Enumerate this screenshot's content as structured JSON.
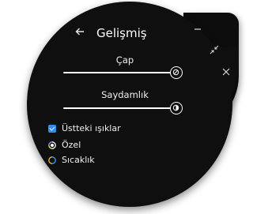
{
  "header": {
    "back_icon": "arrow-left-icon",
    "title": "Gelişmiş"
  },
  "window_controls": {
    "minimize_icon": "minimize-icon",
    "collapse_icon": "collapse-arrows-icon",
    "close_icon": "close-icon"
  },
  "controls": {
    "diameter_label": "Çap",
    "diameter_value": 1.0,
    "diameter_thumb_icon": "circle-slash-icon",
    "opacity_label": "Saydamlık",
    "opacity_value": 1.0,
    "opacity_thumb_icon": "half-circle-contrast-icon"
  },
  "options": [
    {
      "label": "Üstteki ışıklar",
      "checked": true,
      "kind": "checkbox",
      "color": "#2f8df0"
    },
    {
      "label": "Özel",
      "checked": true,
      "kind": "radio",
      "color": "#ffffff"
    },
    {
      "label": "Sıcaklık",
      "checked": false,
      "kind": "radio",
      "color": "#e8c23a"
    }
  ],
  "colors": {
    "background": "#0f0f0f",
    "text": "#f0f0f0",
    "accent": "#2f8df0"
  }
}
